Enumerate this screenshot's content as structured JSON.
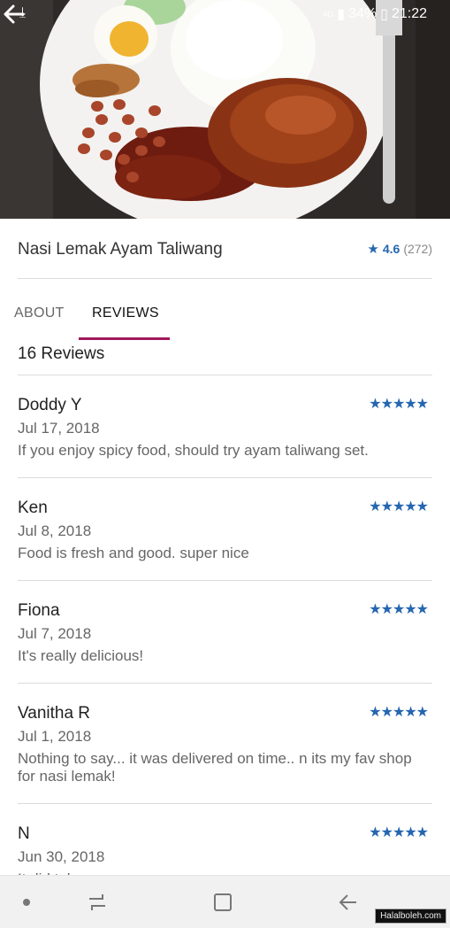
{
  "status_bar": {
    "download_icon": "download-icon",
    "network": "4G",
    "battery": "34%",
    "time": "21:22"
  },
  "header": {
    "back_icon": "back-arrow-icon",
    "photo_description": "food-photo"
  },
  "restaurant": {
    "name": "Nasi Lemak Ayam Taliwang",
    "rating": "4.6",
    "rating_count": "(272)",
    "accent_color": "#2566b0"
  },
  "tabs": [
    {
      "label": "ABOUT",
      "active": false
    },
    {
      "label": "REVIEWS",
      "active": true
    }
  ],
  "tab_indicator_color": "#a0195c",
  "reviews": {
    "count_label": "16 Reviews",
    "items": [
      {
        "name": "Doddy Y",
        "date": "Jul 17, 2018",
        "text": "If you enjoy spicy food, should try ayam taliwang set.",
        "stars": 5
      },
      {
        "name": "Ken",
        "date": "Jul 8, 2018",
        "text": "Food is fresh and good. super nice",
        "stars": 5
      },
      {
        "name": "Fiona",
        "date": "Jul 7, 2018",
        "text": "It's really delicious!",
        "stars": 5
      },
      {
        "name": "Vanitha R",
        "date": "Jul 1, 2018",
        "text": "Nothing to say...  it was delivered on time..  n its my fav shop for nasi lemak!",
        "stars": 5
      },
      {
        "name": "N",
        "date": "Jun 30, 2018",
        "text": "It did take",
        "stars": 5
      }
    ]
  },
  "nav": {
    "dot_icon": "dot-icon",
    "recent_icon": "recent-apps-icon",
    "home_icon": "home-icon",
    "back_icon": "back-icon"
  },
  "watermark": "Halalboleh.com"
}
